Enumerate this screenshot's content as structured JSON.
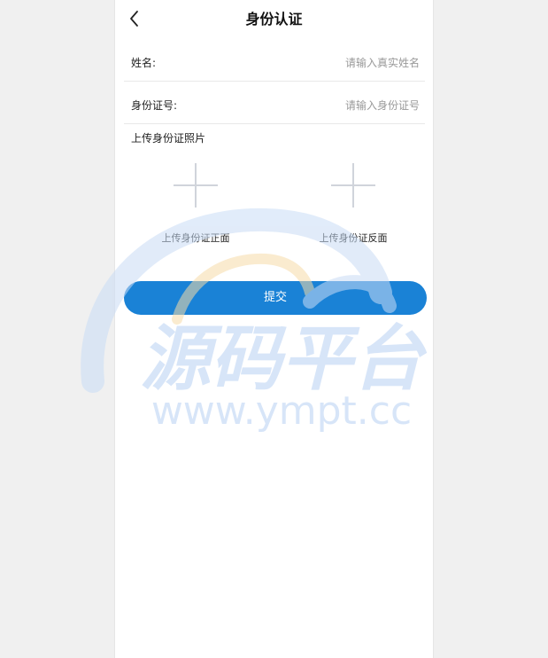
{
  "header": {
    "title": "身份认证",
    "back_icon": "chevron-left-icon"
  },
  "form": {
    "name": {
      "label": "姓名:",
      "placeholder": "请输入真实姓名",
      "value": ""
    },
    "id_number": {
      "label": "身份证号:",
      "placeholder": "请输入身份证号",
      "value": ""
    },
    "photo_section_label": "上传身份证照片",
    "upload_front": {
      "label": "上传身份证正面",
      "icon": "plus-icon"
    },
    "upload_back": {
      "label": "上传身份证反面",
      "icon": "plus-icon"
    },
    "submit_label": "提交"
  },
  "watermark": {
    "title": "源码平台",
    "url": "www.ympt.cc"
  },
  "colors": {
    "primary": "#1a82d6",
    "background": "#f0f0f0",
    "panel": "#ffffff",
    "divider": "#e8e8e8",
    "plus": "#d0d4db",
    "watermark": "#c9dcf5",
    "watermark_accent": "#f7dca8"
  }
}
